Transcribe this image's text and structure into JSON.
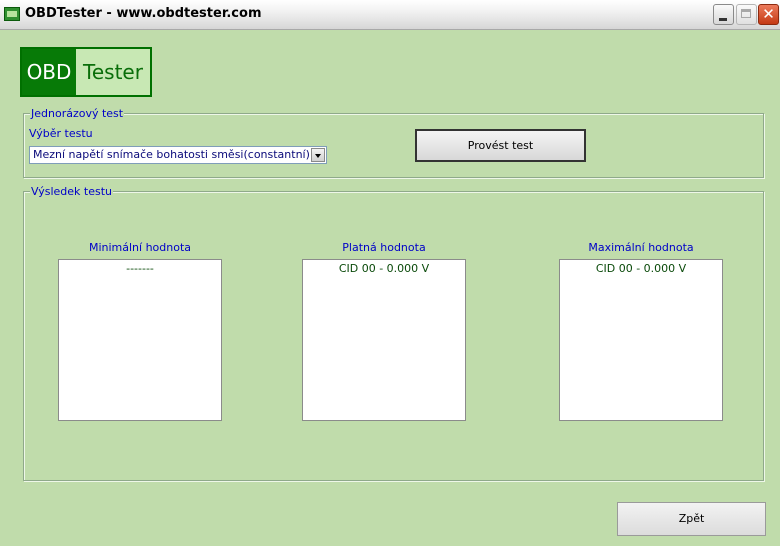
{
  "window": {
    "title": "OBDTester - www.obdtester.com",
    "close_glyph": "✕"
  },
  "logo": {
    "part_a": "OBD",
    "part_b": "Tester"
  },
  "single_test": {
    "legend": "Jednorázový test",
    "select_label": "Výběr testu",
    "selected_test": "Mezní napětí snímače bohatosti směsi(constantní)",
    "run_button": "Provést test"
  },
  "results": {
    "legend": "Výsledek testu",
    "columns": [
      {
        "label": "Minimální hodnota",
        "value": "-------"
      },
      {
        "label": "Platná hodnota",
        "value": "CID 00 - 0.000 V"
      },
      {
        "label": "Maximální hodnota",
        "value": "CID 00 - 0.000 V"
      }
    ]
  },
  "back_button": "Zpět",
  "colors": {
    "background": "#c0dcab",
    "label_blue": "#0000c8",
    "logo_green": "#077a07"
  }
}
